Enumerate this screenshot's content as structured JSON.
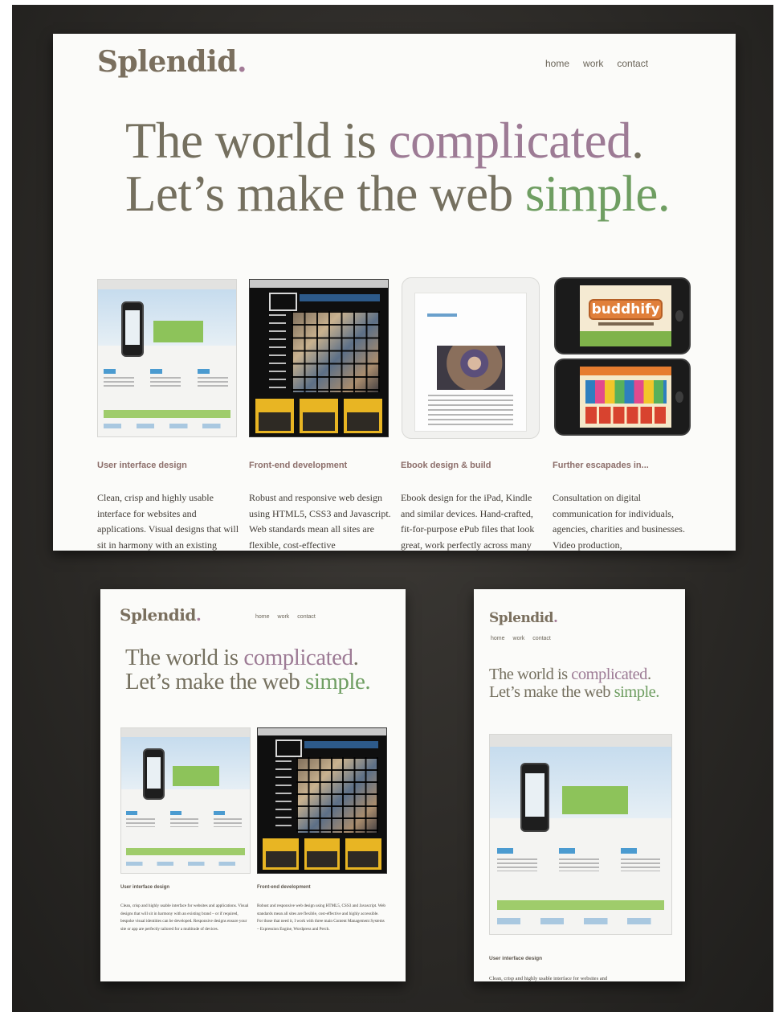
{
  "brand": {
    "name": "Splendid",
    "dot": "."
  },
  "nav": {
    "home": "home",
    "work": "work",
    "contact": "contact"
  },
  "headline": {
    "line1_a": "The world is ",
    "line1_b": "complicated",
    "line1_c": ".",
    "line2_a": "Let’s make the web ",
    "line2_b": "simple",
    "line2_c": "."
  },
  "services": [
    {
      "title": "User interface design",
      "text": "Clean, crisp and highly usable interface for websites and applications. Visual designs that will sit in harmony with an existing"
    },
    {
      "title": "Front-end development",
      "text": "Robust and responsive web design using HTML5, CSS3 and Javascript. Web standards mean all sites are flexible, cost-effective"
    },
    {
      "title": "Ebook design & build",
      "text": "Ebook design for the iPad, Kindle and similar devices. Hand-crafted, fit-for-purpose ePub files that look great, work perfectly across many"
    },
    {
      "title": "Further escapades in...",
      "text": "Consultation on digital communication for individuals, agencies, charities and businesses. Video production,"
    }
  ],
  "tablet_services": [
    {
      "title": "User interface design",
      "text": "Clean, crisp and highly usable interface for websites and applications. Visual designs that will sit in harmony with an existing brand – or if required, bespoke visual identities can be developed. Responsive designs ensure your site or app are perfectly tailored for a multitude of devices."
    },
    {
      "title": "Front-end development",
      "text": "Robust and responsive web design using HTML5, CSS3 and Javascript. Web standards mean all sites are flexible, cost-effective and highly accessible. For those that need it, I work with three main Content Management Systems – Expression Engine, Wordpress and Perch."
    }
  ],
  "phone_services": [
    {
      "title": "User interface design",
      "text": "Clean, crisp and highly usable interface for websites and"
    }
  ],
  "app_label": "buddhify",
  "colors": {
    "backdrop": "#2e2c29",
    "page": "#fbfbf9",
    "headline": "#75705f",
    "accent_purple": "#9d7b95",
    "accent_green": "#6f9e62",
    "caption": "#8c6e6a"
  }
}
